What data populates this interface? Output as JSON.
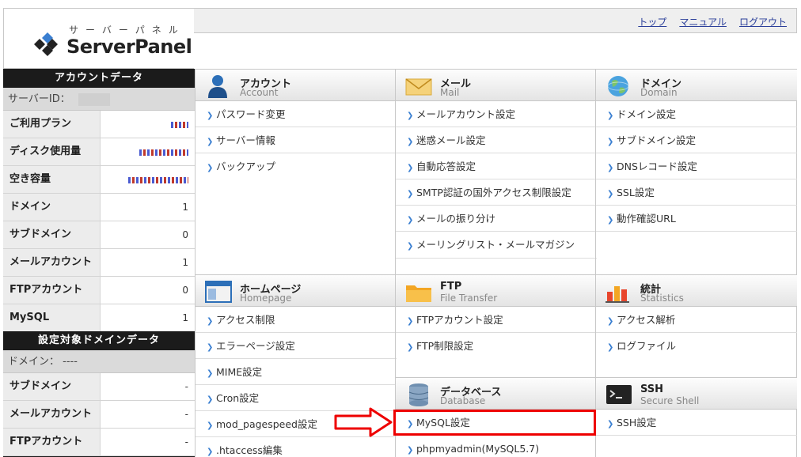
{
  "logo": {
    "kana": "サーバーパネル",
    "name": "ServerPanel"
  },
  "toplinks": [
    "トップ",
    "マニュアル",
    "ログアウト"
  ],
  "left": {
    "account_title": "アカウントデータ",
    "server_id_label": "サーバーID：",
    "rows": [
      {
        "label": "ご利用プラン",
        "value": ""
      },
      {
        "label": "ディスク使用量",
        "value": ""
      },
      {
        "label": "空き容量",
        "value": ""
      },
      {
        "label": "ドメイン",
        "value": "1"
      },
      {
        "label": "サブドメイン",
        "value": "0"
      },
      {
        "label": "メールアカウント",
        "value": "1"
      },
      {
        "label": "FTPアカウント",
        "value": "0"
      },
      {
        "label": "MySQL",
        "value": "1"
      }
    ],
    "domain_title": "設定対象ドメインデータ",
    "domain_label": "ドメイン：",
    "domain_value": "----",
    "rows2": [
      {
        "label": "サブドメイン",
        "value": "-"
      },
      {
        "label": "メールアカウント",
        "value": "-"
      },
      {
        "label": "FTPアカウント",
        "value": "-"
      }
    ]
  },
  "sections": {
    "account": {
      "title": "アカウント",
      "sub": "Account",
      "items": [
        "パスワード変更",
        "サーバー情報",
        "バックアップ"
      ]
    },
    "mail": {
      "title": "メール",
      "sub": "Mail",
      "items": [
        "メールアカウント設定",
        "迷惑メール設定",
        "自動応答設定",
        "SMTP認証の国外アクセス制限設定",
        "メールの振り分け",
        "メーリングリスト・メールマガジン"
      ]
    },
    "domain": {
      "title": "ドメイン",
      "sub": "Domain",
      "items": [
        "ドメイン設定",
        "サブドメイン設定",
        "DNSレコード設定",
        "SSL設定",
        "動作確認URL"
      ]
    },
    "homepage": {
      "title": "ホームページ",
      "sub": "Homepage",
      "items": [
        "アクセス制限",
        "エラーページ設定",
        "MIME設定",
        "Cron設定",
        "mod_pagespeed設定",
        ".htaccess編集"
      ]
    },
    "ftp": {
      "title": "FTP",
      "sub": "File Transfer",
      "items": [
        "FTPアカウント設定",
        "FTP制限設定"
      ]
    },
    "stats": {
      "title": "統計",
      "sub": "Statistics",
      "items": [
        "アクセス解析",
        "ログファイル"
      ]
    },
    "database": {
      "title": "データベース",
      "sub": "Database",
      "items": [
        "MySQL設定",
        "phpmyadmin(MySQL5.7)"
      ]
    },
    "ssh": {
      "title": "SSH",
      "sub": "Secure Shell",
      "items": [
        "SSH設定"
      ]
    }
  },
  "colors": {
    "highlight": "#e00000",
    "link": "#2b3f9a"
  }
}
